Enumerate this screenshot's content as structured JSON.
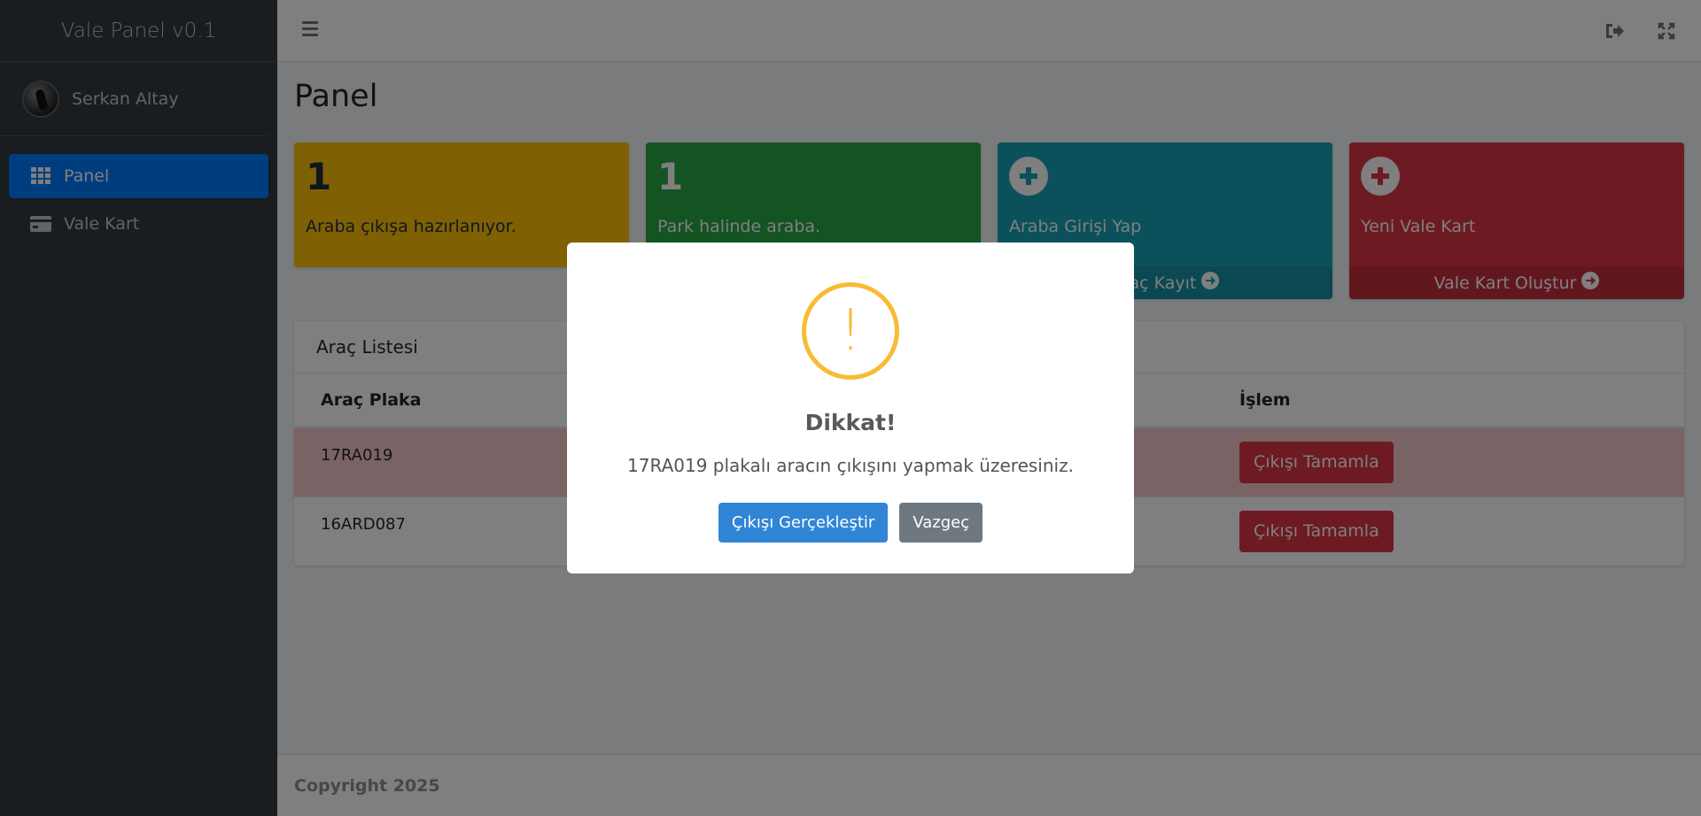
{
  "sidebar": {
    "brand": "Vale Panel v0.1",
    "user_name": "Serkan Altay",
    "items": [
      {
        "label": "Panel",
        "icon": "grid-icon",
        "active": true
      },
      {
        "label": "Vale Kart",
        "icon": "card-icon",
        "active": false
      }
    ]
  },
  "header": {
    "icons": [
      "menu-icon",
      "logout-icon",
      "fullscreen-icon"
    ]
  },
  "main": {
    "title": "Panel",
    "boxes": [
      {
        "number": "1",
        "text": "Araba çıkışa hazırlanıyor.",
        "color": "#ffc107"
      },
      {
        "number": "1",
        "text": "Park halinde araba.",
        "color": "#28a745"
      },
      {
        "text": "Araba Girişi Yap",
        "link": "Araç Kayıt",
        "color": "#17a2b8"
      },
      {
        "text": "Yeni Vale Kart",
        "link": "Vale Kart Oluştur",
        "color": "#dc3545"
      }
    ],
    "table": {
      "title": "Araç Listesi",
      "headers": [
        "Araç Plaka",
        "İşlem"
      ],
      "rows": [
        {
          "plate": "17RA019",
          "action": "Çıkışı Tamamla"
        },
        {
          "plate": "16ARD087",
          "action": "Çıkışı Tamamla"
        }
      ]
    }
  },
  "footer": {
    "copyright": "Copyright 2025"
  },
  "modal": {
    "icon": "!",
    "title": "Dikkat!",
    "text": "17RA019 plakalı aracın çıkışını yapmak üzeresiniz.",
    "confirm_label": "Çıkışı Gerçekleştir",
    "cancel_label": "Vazgeç"
  }
}
